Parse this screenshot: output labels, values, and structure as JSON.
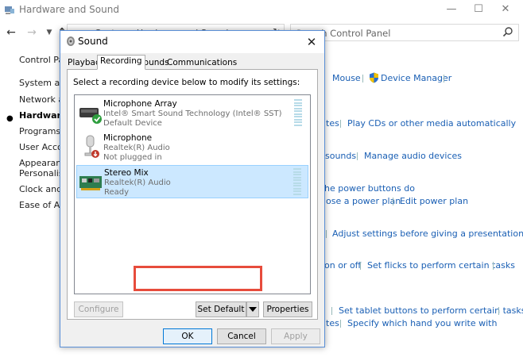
{
  "control_panel": {
    "title": "Hardware and Sound",
    "address": "Contro  >  Hardware and Sound",
    "search_placeholder": "Search Control Panel",
    "left_nav": [
      {
        "label": "Control Panel Home"
      },
      {
        "label": "System and Security"
      },
      {
        "label": "Network and Internet"
      },
      {
        "label": "Hardware and Sound"
      },
      {
        "label": "Programs"
      },
      {
        "label": "User Accounts"
      },
      {
        "label": "Appearance and"
      },
      {
        "label": "Personalisation"
      },
      {
        "label": "Clock and Region"
      },
      {
        "label": "Ease of Access"
      }
    ],
    "links": {
      "mouse": "Mouse",
      "device_manager": "Device Manager",
      "autoplay_tail": "tes",
      "play_cds": "Play CDs or other media automatically",
      "sounds_tail": "sounds",
      "manage_audio": "Manage audio devices",
      "power_buttons": "he power buttons do",
      "power_plan": "ose a power plan",
      "edit_power_plan": "Edit power plan",
      "presentation": "Adjust settings before giving a presentation",
      "onoff": "on or off",
      "flicks": "Set flicks to perform certain tasks",
      "tablet_buttons": "Set tablet buttons to perform certain tasks",
      "hand_tail": "tes",
      "hand": "Specify which hand you write with"
    }
  },
  "dialog": {
    "title": "Sound",
    "tabs": [
      "Playback",
      "Recording",
      "Sounds",
      "Communications"
    ],
    "active_tab": "Recording",
    "instructions": "Select a recording device below to modify its settings:",
    "devices": [
      {
        "name": "Microphone Array",
        "desc": "Intel® Smart Sound Technology (Intel® SST)",
        "status": "Default Device",
        "icon": "microphone-array-icon",
        "selected": false
      },
      {
        "name": "Microphone",
        "desc": "Realtek(R) Audio",
        "status": "Not plugged in",
        "icon": "microphone-icon",
        "selected": false
      },
      {
        "name": "Stereo Mix",
        "desc": "Realtek(R) Audio",
        "status": "Ready",
        "icon": "sound-card-icon",
        "selected": true
      }
    ],
    "buttons": {
      "configure": "Configure",
      "set_default": "Set Default",
      "properties": "Properties",
      "ok": "OK",
      "cancel": "Cancel",
      "apply": "Apply"
    }
  },
  "colors": {
    "link": "#1a5fb4",
    "selection": "#cce8ff",
    "highlight": "#e74c3c"
  }
}
